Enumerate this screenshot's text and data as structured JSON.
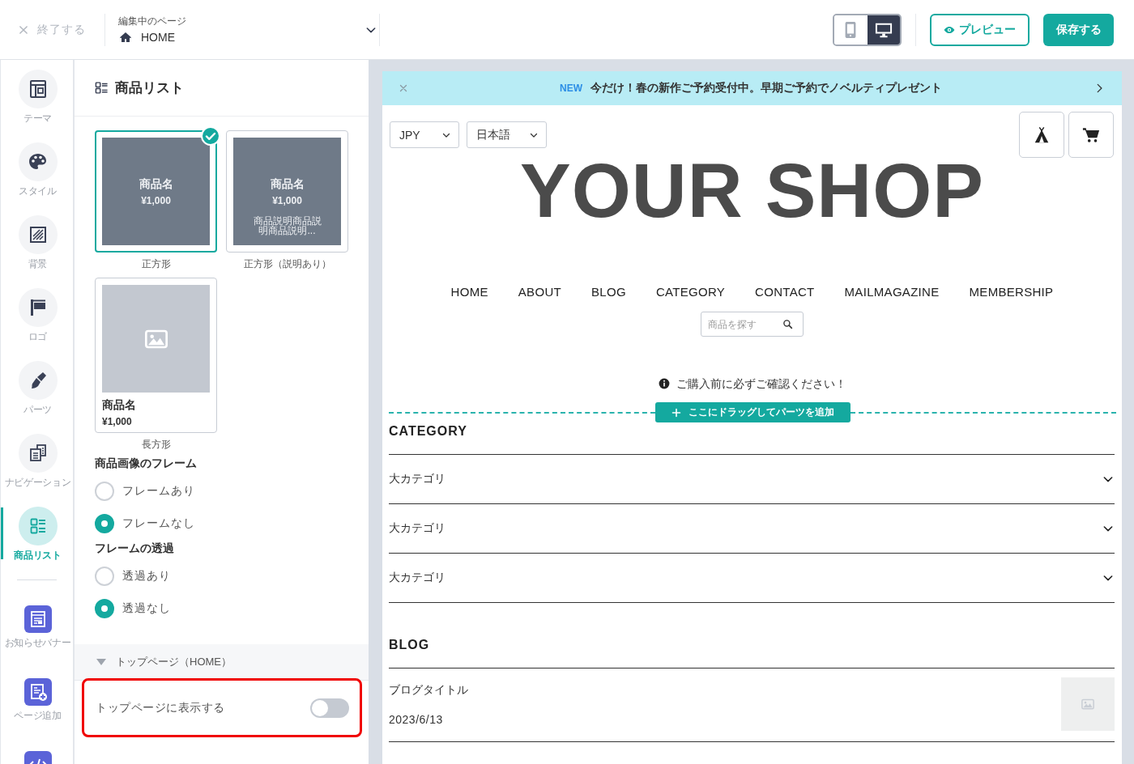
{
  "topbar": {
    "exit": "終了する",
    "page_select": {
      "caption": "編集中のページ",
      "value": "HOME"
    },
    "device_toggle": [
      {
        "kind": "mobile",
        "selected": false
      },
      {
        "kind": "desktop",
        "selected": true
      }
    ],
    "preview_button": "プレビュー",
    "save_button": "保存する"
  },
  "sidebar": {
    "items": [
      {
        "kind": "circle",
        "label": "テーマ",
        "selected": false
      },
      {
        "kind": "circle",
        "label": "スタイル",
        "selected": false
      },
      {
        "kind": "circle",
        "label": "背景",
        "selected": false
      },
      {
        "kind": "circle",
        "label": "ロゴ",
        "selected": false
      },
      {
        "kind": "circle",
        "label": "パーツ",
        "selected": false
      },
      {
        "kind": "circle",
        "label": "ナビゲーション",
        "selected": false
      },
      {
        "kind": "circle",
        "label": "商品リスト",
        "selected": true
      },
      {
        "kind": "tile",
        "label": "お知らせバナー",
        "selected": false
      },
      {
        "kind": "tile",
        "label": "ページ追加",
        "selected": false
      },
      {
        "kind": "tile",
        "selected": false
      }
    ]
  },
  "panel": {
    "title": "商品リスト",
    "layouts": [
      {
        "kind": "square",
        "selected": true,
        "name": "商品名",
        "price": "¥1,000",
        "caption": "正方形"
      },
      {
        "kind": "square",
        "selected": false,
        "name": "商品名",
        "price": "¥1,000",
        "description": "商品説明商品説明商品説明...",
        "caption": "正方形（説明あり）"
      },
      {
        "kind": "rectangle",
        "selected": false,
        "name": "商品名",
        "price": "¥1,000",
        "caption": "長方形"
      }
    ],
    "option_groups": [
      {
        "title": "商品画像のフレーム",
        "options": [
          {
            "label": "フレームあり",
            "selected": false
          },
          {
            "label": "フレームなし",
            "selected": true
          }
        ]
      },
      {
        "title": "フレームの透過",
        "options": [
          {
            "label": "透過あり",
            "selected": false
          },
          {
            "label": "透過なし",
            "selected": true
          }
        ]
      }
    ],
    "section": {
      "title": "トップページ（HOME）",
      "expanded": true,
      "toggle": {
        "label": "トップページに表示する",
        "on": false,
        "highlighted": true
      }
    }
  },
  "preview": {
    "announcement": {
      "badge": "NEW",
      "text": "今だけ！春の新作ご予約受付中。早期ご予約でノベルティプレゼント"
    },
    "selects": [
      "JPY",
      "日本語"
    ],
    "logo": "YOUR SHOP",
    "nav": [
      "HOME",
      "ABOUT",
      "BLOG",
      "CATEGORY",
      "CONTACT",
      "MAILMAGAZINE",
      "MEMBERSHIP"
    ],
    "search": {
      "placeholder": "商品を探す"
    },
    "notice": "ご購入前に必ずご確認ください！",
    "drop_zone": "ここにドラッグしてパーツを追加",
    "category": {
      "title": "CATEGORY",
      "items": [
        {
          "label": "大カテゴリ",
          "expanded": false
        },
        {
          "label": "大カテゴリ",
          "expanded": false
        },
        {
          "label": "大カテゴリ",
          "expanded": false
        }
      ]
    },
    "blog": {
      "title": "BLOG",
      "posts": [
        {
          "title": "ブログタイトル",
          "date": "2023/6/13"
        }
      ]
    }
  }
}
